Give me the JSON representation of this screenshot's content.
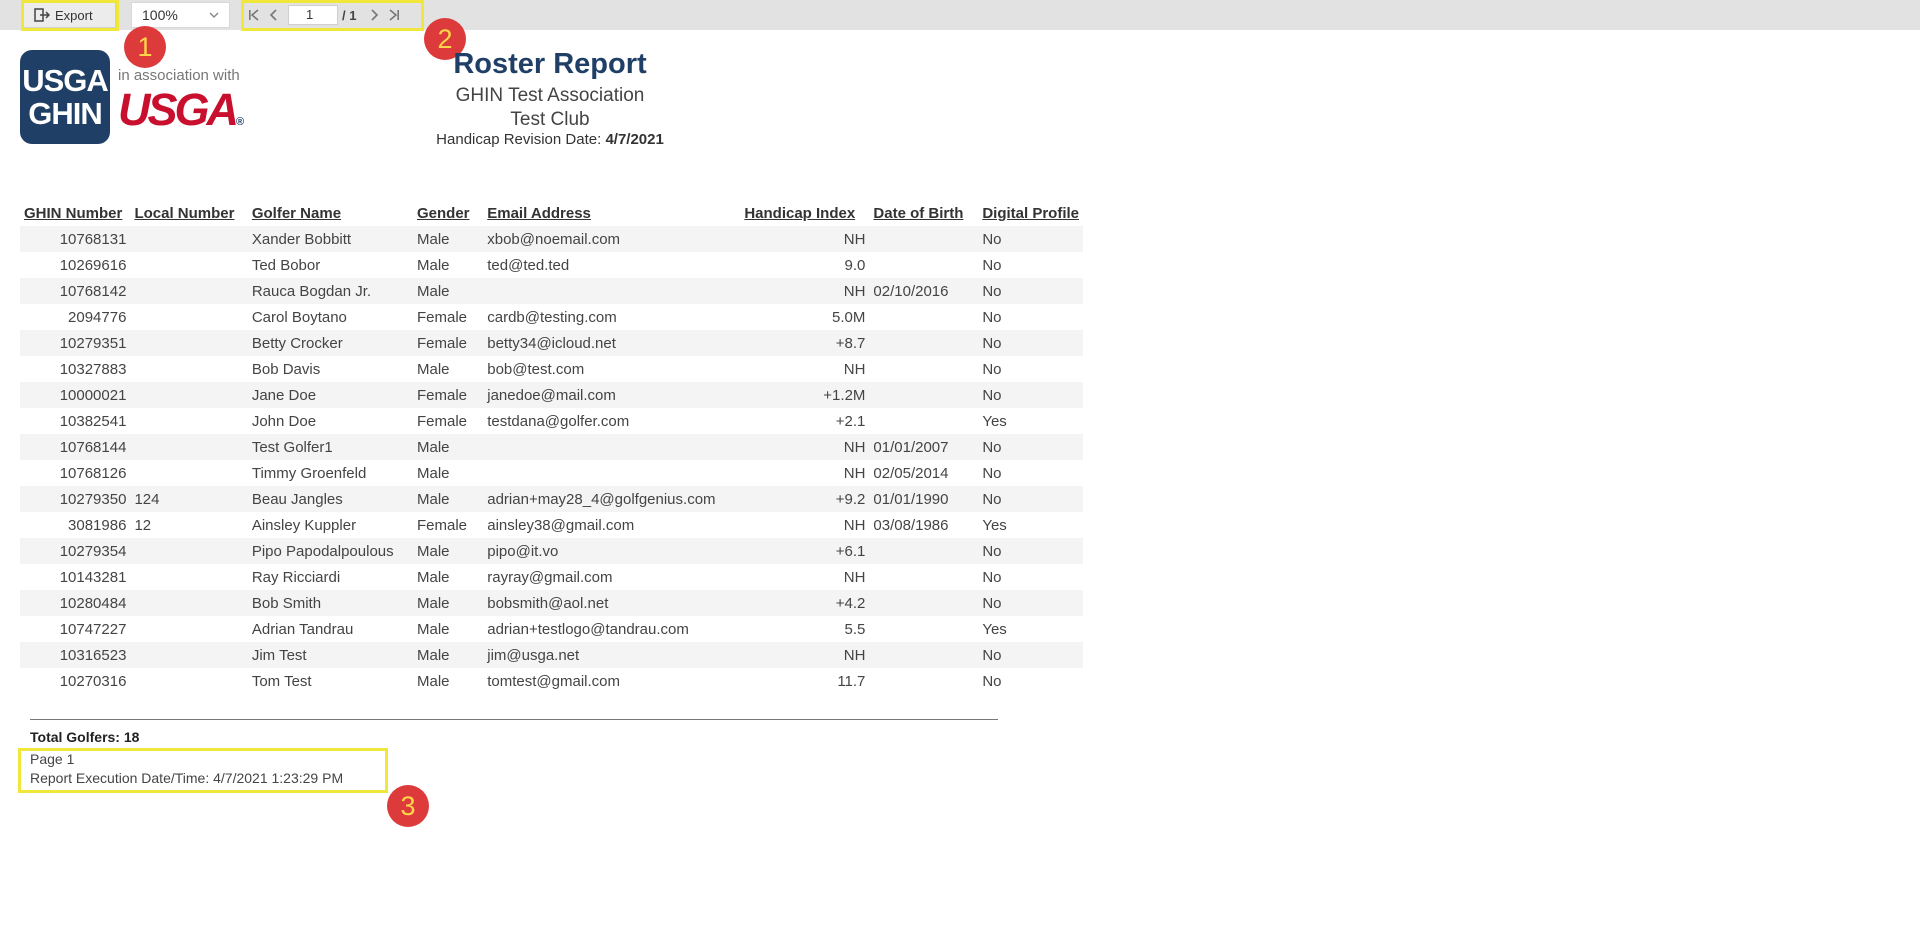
{
  "toolbar": {
    "export_label": "Export",
    "zoom_value": "100%",
    "page_input": "1",
    "page_total": "/ 1"
  },
  "badges": [
    "1",
    "2",
    "3"
  ],
  "logos": {
    "ghin_line1": "USGA",
    "ghin_line2": "GHIN",
    "assoc_text": "in association with",
    "usga_text": "USGA",
    "usga_reg": "®"
  },
  "report": {
    "title": "Roster Report",
    "association": "GHIN Test Association",
    "club": "Test Club",
    "revision_label": "Handicap Revision Date:",
    "revision_date": "4/7/2021"
  },
  "table": {
    "headers": [
      "GHIN Number",
      "Local Number",
      "Golfer Name",
      "Gender",
      "Email Address",
      "Handicap Index",
      "Date of Birth",
      "Digital Profile"
    ],
    "rows": [
      [
        "10768131",
        "",
        "Xander Bobbitt",
        "Male",
        "xbob@noemail.com",
        "NH",
        "",
        "No"
      ],
      [
        "10269616",
        "",
        "Ted Bobor",
        "Male",
        "ted@ted.ted",
        "9.0",
        "",
        "No"
      ],
      [
        "10768142",
        "",
        "Rauca Bogdan Jr.",
        "Male",
        "",
        "NH",
        "02/10/2016",
        "No"
      ],
      [
        "2094776",
        "",
        "Carol Boytano",
        "Female",
        "cardb@testing.com",
        "5.0M",
        "",
        "No"
      ],
      [
        "10279351",
        "",
        "Betty Crocker",
        "Female",
        "betty34@icloud.net",
        "+8.7",
        "",
        "No"
      ],
      [
        "10327883",
        "",
        "Bob Davis",
        "Male",
        "bob@test.com",
        "NH",
        "",
        "No"
      ],
      [
        "10000021",
        "",
        "Jane Doe",
        "Female",
        "janedoe@mail.com",
        "+1.2M",
        "",
        "No"
      ],
      [
        "10382541",
        "",
        "John Doe",
        "Female",
        "testdana@golfer.com",
        "+2.1",
        "",
        "Yes"
      ],
      [
        "10768144",
        "",
        "Test Golfer1",
        "Male",
        "",
        "NH",
        "01/01/2007",
        "No"
      ],
      [
        "10768126",
        "",
        "Timmy Groenfeld",
        "Male",
        "",
        "NH",
        "02/05/2014",
        "No"
      ],
      [
        "10279350",
        "124",
        "Beau Jangles",
        "Male",
        "adrian+may28_4@golfgenius.com",
        "+9.2",
        "01/01/1990",
        "No"
      ],
      [
        "3081986",
        "12",
        "Ainsley Kuppler",
        "Female",
        "ainsley38@gmail.com",
        "NH",
        "03/08/1986",
        "Yes"
      ],
      [
        "10279354",
        "",
        "Pipo Papodalpoulous",
        "Male",
        "pipo@it.vo",
        "+6.1",
        "",
        "No"
      ],
      [
        "10143281",
        "",
        "Ray Ricciardi",
        "Male",
        "rayray@gmail.com",
        "NH",
        "",
        "No"
      ],
      [
        "10280484",
        "",
        "Bob Smith",
        "Male",
        "bobsmith@aol.net",
        "+4.2",
        "",
        "No"
      ],
      [
        "10747227",
        "",
        "Adrian Tandrau",
        "Male",
        "adrian+testlogo@tandrau.com",
        "5.5",
        "",
        "Yes"
      ],
      [
        "10316523",
        "",
        "Jim Test",
        "Male",
        "jim@usga.net",
        "NH",
        "",
        "No"
      ],
      [
        "10270316",
        "",
        "Tom Test",
        "Male",
        "tomtest@gmail.com",
        "11.7",
        "",
        "No"
      ]
    ]
  },
  "footer": {
    "total": "Total Golfers: 18",
    "page": "Page 1",
    "execution": "Report Execution Date/Time: 4/7/2021 1:23:29 PM"
  },
  "colors": {
    "toolbar_bg": "#e2e2e2",
    "highlight": "#f1e63a",
    "badge": "#dd3b3b",
    "brand_navy": "#1f3f66",
    "brand_red": "#c8102e"
  }
}
